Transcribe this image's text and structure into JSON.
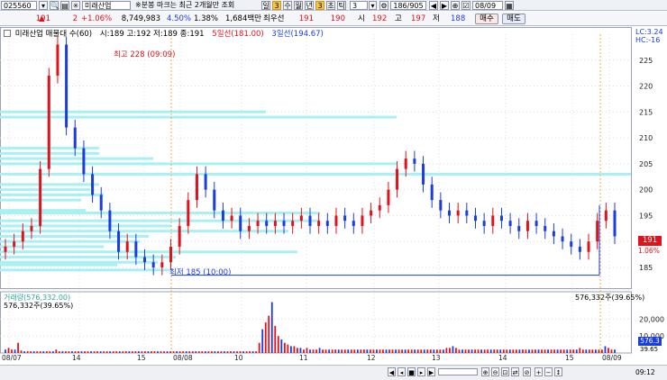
{
  "toolbar": {
    "code": "025560",
    "name": "미래산업",
    "notice": "※분봉 마크는 최근 2개월만 조회",
    "period_btns": [
      "일",
      "3",
      "수",
      "월",
      "년"
    ],
    "minute_value": "3",
    "extra_btns": [
      "초",
      "틱",
      "3"
    ],
    "count": "186/905",
    "date": "08/09"
  },
  "quote": {
    "price": "191",
    "arrow": "▲",
    "change": "2",
    "change_pct": "+1.06%",
    "volume": "8,749,983",
    "pct2": "4.50%",
    "pct3": "1.38%",
    "amount": "1,684백만",
    "best_ask_label": "최우선",
    "best_ask": "191",
    "best_bid": "190",
    "open_label": "시",
    "open": "192",
    "high_label": "고",
    "high": "197",
    "low_label": "저",
    "low": "188",
    "buy_btn": "매수",
    "sell_btn": "매도"
  },
  "legend": {
    "title": "미래산업 매물대 수(60)",
    "ohlc": "시:189 고:192 저:189 종:191",
    "ma5": "5일선(181.00)",
    "ma3": "3일선(194.67)"
  },
  "price_annotations": {
    "high": "최고 228 (09:09)",
    "low": "최저 185 (10:00)"
  },
  "right_top": {
    "lc": "LC:3.24",
    "hc": "HC:-16"
  },
  "current_price_tag": "191",
  "current_price_sub": "1.06%",
  "volume_panel": {
    "title": "거래량(576,332.00)",
    "left_label": "576,332주(39.65%)",
    "right_label": "576,332주(39.65%)",
    "current_tag": "576.3",
    "current_sub": "39.65"
  },
  "time_axis_right": "09:12",
  "colors": {
    "up": "#e0121a",
    "down": "#1a3de0",
    "profile": "#a9f0f4",
    "grid": "#d8dde8",
    "session": "#e8b040"
  },
  "chart_data": [
    {
      "type": "line",
      "title": "",
      "xlabel": "",
      "ylabel": "",
      "x_ticks": [
        "08/07",
        "14",
        "15",
        "08/08",
        "10",
        "11",
        "12",
        "13",
        "14",
        "15",
        "08/09"
      ],
      "y_ticks": [
        185,
        190,
        195,
        200,
        205,
        210,
        215,
        220,
        225
      ],
      "ylim": [
        181,
        230
      ],
      "series": [
        {
          "values": [
            189,
            190,
            192,
            193,
            204,
            222,
            228,
            212,
            208,
            203,
            199,
            196,
            192,
            188,
            190,
            187,
            186,
            185,
            186,
            189,
            193,
            198,
            203,
            200,
            196,
            194,
            195,
            192,
            193,
            194,
            193,
            194,
            193,
            194,
            195,
            193,
            194,
            193,
            195,
            194,
            193,
            195,
            196,
            197,
            200,
            204,
            206,
            205,
            201,
            198,
            196,
            195,
            196,
            195,
            194,
            193,
            195,
            194,
            193,
            192,
            194,
            193,
            192,
            191,
            190,
            189,
            188,
            190,
            194,
            196,
            191
          ]
        }
      ]
    },
    {
      "type": "bar",
      "title": "",
      "ylabel": "",
      "y_ticks": [
        "20,000",
        "10,000"
      ],
      "values": [
        2,
        3,
        2,
        2,
        6,
        1.5,
        1,
        1,
        1,
        1,
        1,
        1,
        1,
        1,
        1,
        1,
        2,
        1,
        1,
        1,
        1,
        1,
        1,
        1,
        1,
        1,
        1,
        1,
        1,
        1,
        1,
        1,
        1,
        1,
        1,
        1,
        1,
        1,
        1,
        1,
        1,
        1,
        1,
        1,
        1,
        1,
        1,
        1,
        1,
        1,
        1,
        1,
        1,
        1,
        1,
        1,
        1,
        1,
        1,
        1,
        1,
        1,
        1,
        1,
        1,
        1,
        1,
        1,
        1,
        1,
        1,
        1,
        1,
        1,
        1,
        1,
        1,
        1,
        1,
        1,
        6,
        14,
        18,
        22,
        30,
        16,
        10,
        8,
        6,
        5,
        4,
        4,
        3,
        3,
        2,
        3,
        2,
        2,
        2,
        3,
        2,
        2,
        2,
        2,
        2,
        2,
        2,
        2,
        2,
        2,
        2,
        2,
        2,
        2,
        2,
        2,
        2,
        2,
        2,
        2,
        2,
        2,
        2,
        2,
        2,
        2,
        2,
        2,
        2,
        2,
        2,
        2,
        2,
        2,
        2,
        2,
        2,
        2,
        2,
        3,
        3,
        4,
        3,
        2,
        2,
        2,
        2,
        2,
        2,
        2,
        2,
        2,
        2,
        2,
        2,
        2,
        2,
        2,
        2,
        2,
        2,
        2,
        2,
        2,
        2,
        2,
        2,
        2,
        2,
        2,
        2,
        2,
        2,
        2,
        2,
        2,
        2,
        2,
        2,
        2,
        2,
        3,
        2,
        2,
        2,
        2,
        2,
        2,
        2,
        4,
        3,
        2,
        2
      ]
    }
  ]
}
